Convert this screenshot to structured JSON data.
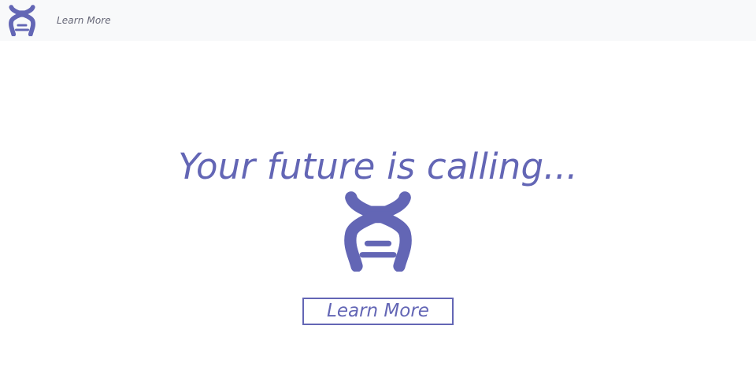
{
  "navbar": {
    "logo_icon": "dna-icon",
    "link_label": "Learn More"
  },
  "hero": {
    "title": "Your future is calling...",
    "logo_icon": "dna-icon",
    "button_label": "Learn More"
  },
  "colors": {
    "accent": "#6366b5",
    "navbar_bg": "#f8f9fa",
    "nav_text": "#666777",
    "page_bg": "#ffffff"
  }
}
